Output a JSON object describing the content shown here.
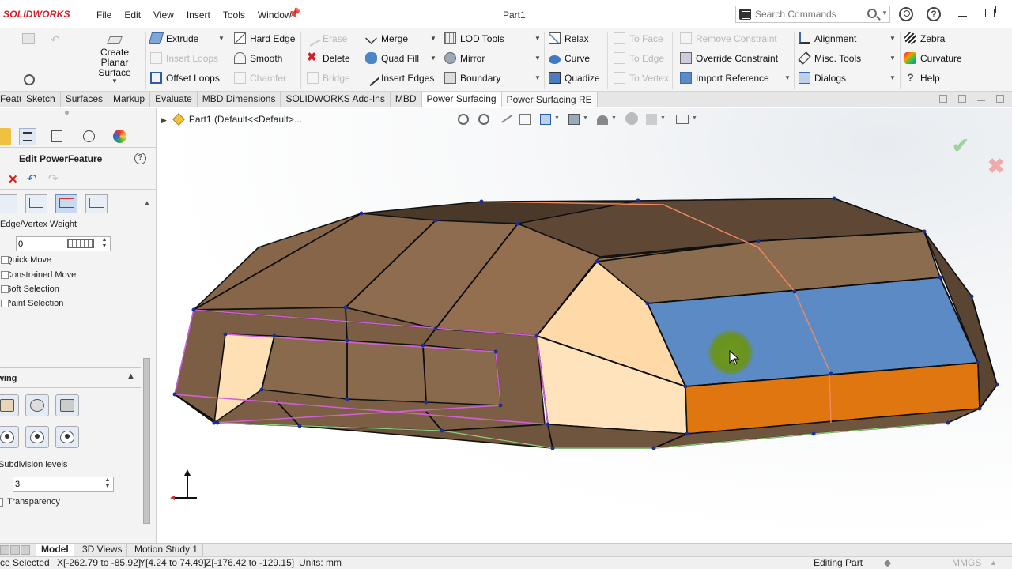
{
  "app": {
    "logo": "SOLIDWORKS",
    "menus": [
      "File",
      "Edit",
      "View",
      "Insert",
      "Tools",
      "Window"
    ],
    "document_title": "Part1",
    "search": {
      "placeholder": "Search Commands"
    }
  },
  "ribbon": {
    "create_planar_surface": "Create Planar Surface",
    "group1": [
      "Extrude",
      "Insert Loops",
      "Offset Loops"
    ],
    "group2": [
      "Hard Edge",
      "Smooth",
      "Chamfer"
    ],
    "group3": [
      "Erase",
      "Delete",
      "Bridge"
    ],
    "group4": [
      "Merge",
      "Quad Fill",
      "Insert Edges"
    ],
    "group5": [
      "LOD Tools",
      "Mirror",
      "Boundary"
    ],
    "group6": [
      "Relax",
      "Curve",
      "Quadize"
    ],
    "group7": [
      "To Face",
      "To Edge",
      "To Vertex"
    ],
    "group8": [
      "Remove Constraint",
      "Override Constraint",
      "Import Reference"
    ],
    "group9": [
      "Alignment",
      "Misc. Tools",
      "Dialogs"
    ],
    "group10": [
      "Zebra",
      "Curvature",
      "Help"
    ]
  },
  "tabs": [
    "Features",
    "Sketch",
    "Surfaces",
    "Markup",
    "Evaluate",
    "MBD Dimensions",
    "SOLIDWORKS Add-Ins",
    "MBD",
    "Power Surfacing",
    "Power Surfacing RE"
  ],
  "feature_tree": {
    "part_label": "Part1  (Default<<Default>..."
  },
  "property_manager": {
    "title": "Edit PowerFeature",
    "weight_label": "Edge/Vertex Weight",
    "weight_value": "0",
    "options": [
      "Quick Move",
      "Constrained Move",
      "Soft Selection",
      "Paint Selection"
    ],
    "display_section": "Drawing",
    "subdivision_label": "Subdivision levels",
    "subdivision_value": "3",
    "transparency_label": "Transparency"
  },
  "bottom_tabs": [
    "Model",
    "3D Views",
    "Motion Study 1"
  ],
  "status": {
    "selection": "ce Selected",
    "x_range": "X[-262.79 to -85.92]",
    "y_range": "Y[4.24 to 74.49]",
    "z_range": "Z[-176.42 to -129.15]",
    "units": "Units: mm",
    "mode": "Editing Part",
    "unit_system": "MMGS"
  },
  "colors": {
    "body_face": "#8b6b4c",
    "body_top": "#5a4533",
    "selected_face": "#5b8ac4",
    "orange_face": "#e0760f",
    "light_face": "#ffdcb0",
    "accent_red": "#d5202a"
  }
}
